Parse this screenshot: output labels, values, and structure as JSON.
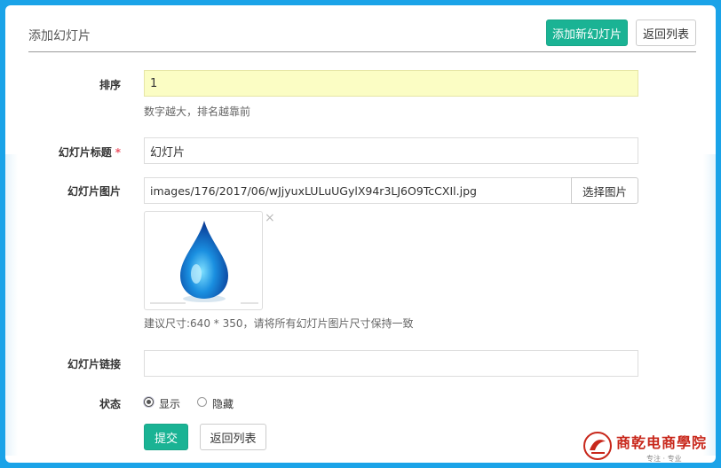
{
  "header": {
    "title": "添加幻灯片",
    "add_button": "添加新幻灯片",
    "back_button": "返回列表"
  },
  "form": {
    "order": {
      "label": "排序",
      "value": "1",
      "help": "数字越大，排名越靠前"
    },
    "title": {
      "label": "幻灯片标题",
      "required_mark": "*",
      "value": "幻灯片"
    },
    "image": {
      "label": "幻灯片图片",
      "value": "images/176/2017/06/wJjyuxLULuUGylX94r3LJ6O9TcCXIl.jpg",
      "select_button": "选择图片",
      "remove_icon": "×",
      "help": "建议尺寸:640 * 350，请将所有幻灯片图片尺寸保持一致"
    },
    "link": {
      "label": "幻灯片链接",
      "value": ""
    },
    "status": {
      "label": "状态",
      "options": [
        {
          "label": "显示",
          "checked": true
        },
        {
          "label": "隐藏",
          "checked": false
        }
      ]
    },
    "submit_button": "提交",
    "back_button": "返回列表"
  },
  "logo": {
    "text": "商乾电商學院",
    "sub": "专注 · 专业"
  },
  "colors": {
    "primary": "#1ab394",
    "frame": "#1aa3e8",
    "required": "#ed5565",
    "highlight_input": "#fbfdc4"
  }
}
